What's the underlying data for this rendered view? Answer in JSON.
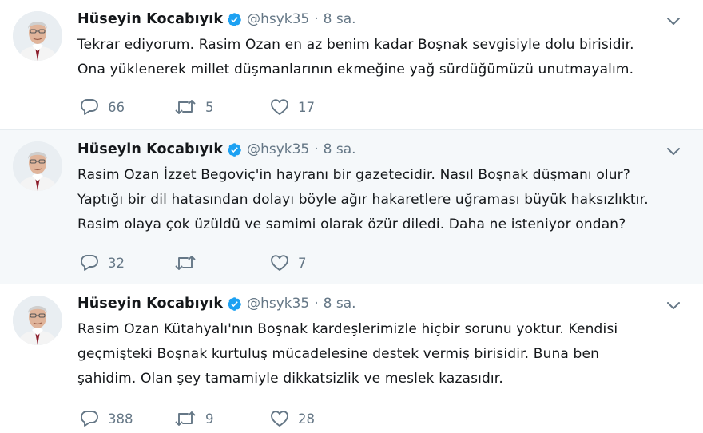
{
  "tweets": [
    {
      "author": "Hüseyin Kocabıyık",
      "handle": "@hsyk35",
      "separator": "·",
      "time": "8 sa.",
      "lines": [
        "Tekrar ediyorum. Rasim Ozan en az benim kadar Boşnak sevgisiyle dolu birisidir.",
        "Ona yüklenerek millet düşmanlarının ekmeğine yağ sürdüğümüzü unutmayalım."
      ],
      "replies": "66",
      "retweets": "5",
      "likes": "17"
    },
    {
      "author": "Hüseyin Kocabıyık",
      "handle": "@hsyk35",
      "separator": "·",
      "time": "8 sa.",
      "lines": [
        "Rasim Ozan İzzet Begoviç'in hayranı bir gazetecidir. Nasıl Boşnak düşmanı olur?",
        "Yaptığı bir dil hatasından dolayı böyle ağır hakaretlere uğraması büyük haksızlıktır.",
        "Rasim olaya çok üzüldü ve samimi olarak özür diledi. Daha ne isteniyor ondan?"
      ],
      "replies": "32",
      "retweets": "",
      "likes": "7"
    },
    {
      "author": "Hüseyin Kocabıyık",
      "handle": "@hsyk35",
      "separator": "·",
      "time": "8 sa.",
      "lines": [
        "Rasim Ozan Kütahyalı'nın Boşnak kardeşlerimizle hiçbir sorunu yoktur. Kendisi",
        "geçmişteki Boşnak kurtuluş mücadelesine destek vermiş birisidir. Buna ben",
        "şahidim. Olan şey tamamiyle dikkatsizlik ve meslek kazasıdır."
      ],
      "replies": "388",
      "retweets": "9",
      "likes": "28"
    }
  ],
  "icons": {
    "verified": "verified-badge-icon",
    "reply": "reply-icon",
    "retweet": "retweet-icon",
    "like": "heart-icon",
    "menu": "chevron-down-icon"
  },
  "colors": {
    "name": "#14171a",
    "meta": "#657786",
    "verified": "#1da1f2",
    "highlight_bg": "#f5f8fa",
    "divider": "#e6ecf0"
  }
}
